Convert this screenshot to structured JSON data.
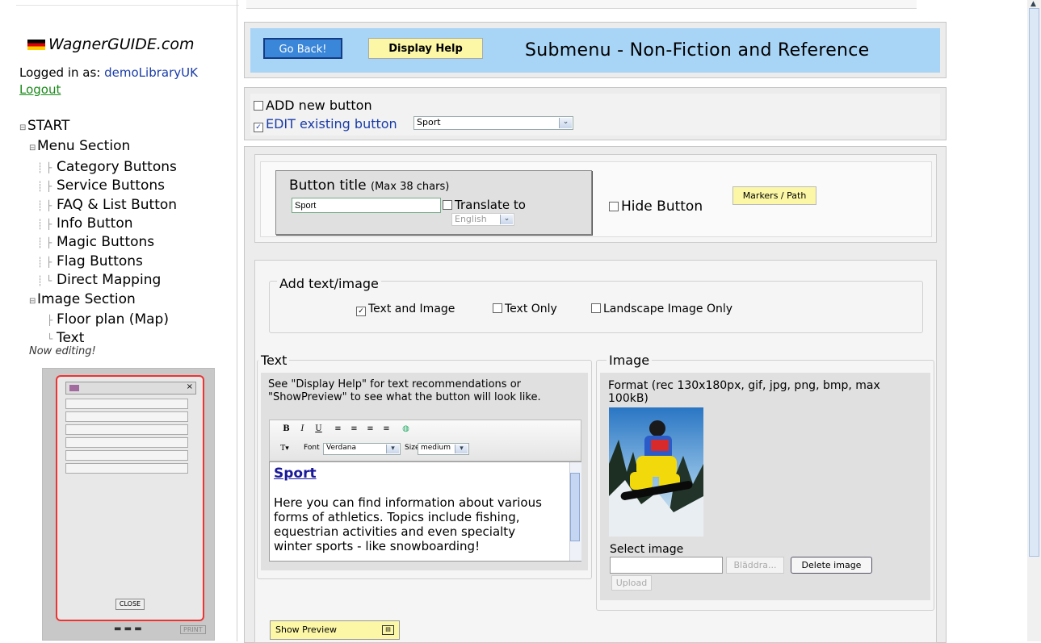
{
  "sidebar": {
    "logo_text": "WagnerGUIDE.com",
    "logged_in_label": "Logged in as:",
    "username": "demoLibraryUK",
    "logout": "Logout",
    "tree": {
      "start": "START",
      "menu_section": "Menu Section",
      "menu_items": [
        "Category Buttons",
        "Service Buttons",
        "FAQ & List Button",
        "Info Button",
        "Magic Buttons",
        "Flag Buttons",
        "Direct Mapping"
      ],
      "image_section": "Image Section",
      "image_items": [
        "Floor plan (Map)",
        "Text"
      ]
    },
    "now_editing": "Now editing!",
    "preview": {
      "close": "CLOSE",
      "print": "PRINT"
    }
  },
  "header": {
    "go_back": "Go Back!",
    "display_help": "Display Help",
    "title": "Submenu - Non-Fiction and Reference"
  },
  "mode": {
    "add_label": "ADD new button",
    "edit_label": "EDIT existing button",
    "edit_selected": "Sport",
    "add_checked": false,
    "edit_checked": true
  },
  "button_settings": {
    "title_label": "Button title",
    "title_hint": "(Max 38 chars)",
    "title_value": "Sport",
    "translate_label": "Translate to",
    "language": "English",
    "hide_label": "Hide Button",
    "markers_path": "Markers / Path"
  },
  "add_text_image": {
    "legend": "Add text/image",
    "options": [
      {
        "label": "Text and Image",
        "checked": true
      },
      {
        "label": "Text Only",
        "checked": false
      },
      {
        "label": "Landscape Image Only",
        "checked": false
      }
    ]
  },
  "text_section": {
    "legend": "Text",
    "help": "See \"Display Help\" for text recommendations or \"ShowPreview\" to see what the button will look like.",
    "toolbar": {
      "font_label": "Font",
      "font_value": "Verdana",
      "size_label": "Size",
      "size_value": "medium"
    },
    "editor_title": "Sport",
    "editor_body": "Here you can find information about various forms of athletics. Topics include fishing, equestrian activities and even specialty winter sports - like snowboarding!"
  },
  "image_section": {
    "legend": "Image",
    "format": "Format (rec 130x180px, gif, jpg, png, bmp, max 100kB)",
    "select_label": "Select image",
    "browse": "Bläddra...",
    "delete": "Delete image",
    "upload": "Upload"
  },
  "show_preview": "Show Preview",
  "colors": {
    "header_bg": "#a8d4f6",
    "go_back_bg": "#3a86d8",
    "help_bg": "#fbf7a6",
    "link_blue": "#1a3ca8",
    "logout_green": "#1a8a1a",
    "preview_frame": "#e33333"
  }
}
